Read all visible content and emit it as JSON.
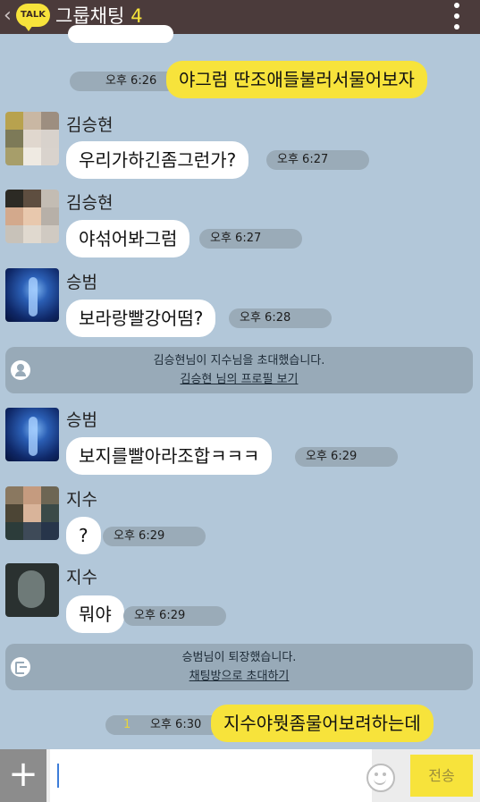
{
  "header": {
    "back_icon": "‹",
    "logo_text": "TALK",
    "title": "그룹채팅",
    "member_count": "4"
  },
  "messages": [
    {
      "type": "mine",
      "text": "야그럼 딴조애들불러서물어보자",
      "time": "오후 6:26"
    },
    {
      "type": "other",
      "sender": "김승현",
      "text": "우리가하긴좀그런가?",
      "time": "오후 6:27"
    },
    {
      "type": "other",
      "sender": "김승현",
      "text": "야섞어봐그럼",
      "time": "오후 6:27"
    },
    {
      "type": "other",
      "sender": "승범",
      "text": "보라랑빨강어떰?",
      "time": "오후 6:28"
    },
    {
      "type": "notice",
      "text": "김승현님이 지수님을 초대했습니다.",
      "link": "김승현 님의 프로필 보기"
    },
    {
      "type": "other",
      "sender": "승범",
      "text": "보지를빨아라조합ㅋㅋㅋ",
      "time": "오후 6:29"
    },
    {
      "type": "other",
      "sender": "지수",
      "text": "?",
      "time": "오후 6:29"
    },
    {
      "type": "other",
      "sender": "지수",
      "text": "뭐야",
      "time": "오후 6:29"
    },
    {
      "type": "notice",
      "text": "승범님이 퇴장했습니다.",
      "link": "채팅방으로 초대하기"
    },
    {
      "type": "mine",
      "unread": "1",
      "text": "지수야뭣좀물어보려하는데",
      "time": "오후 6:30"
    }
  ],
  "input_bar": {
    "plus_label": "+",
    "send_label": "전송",
    "emoji_icon": "smiley-icon"
  },
  "colors": {
    "background": "#b2c7d9",
    "header": "#4b3b3b",
    "my_bubble": "#f7e33b",
    "other_bubble": "#ffffff"
  }
}
